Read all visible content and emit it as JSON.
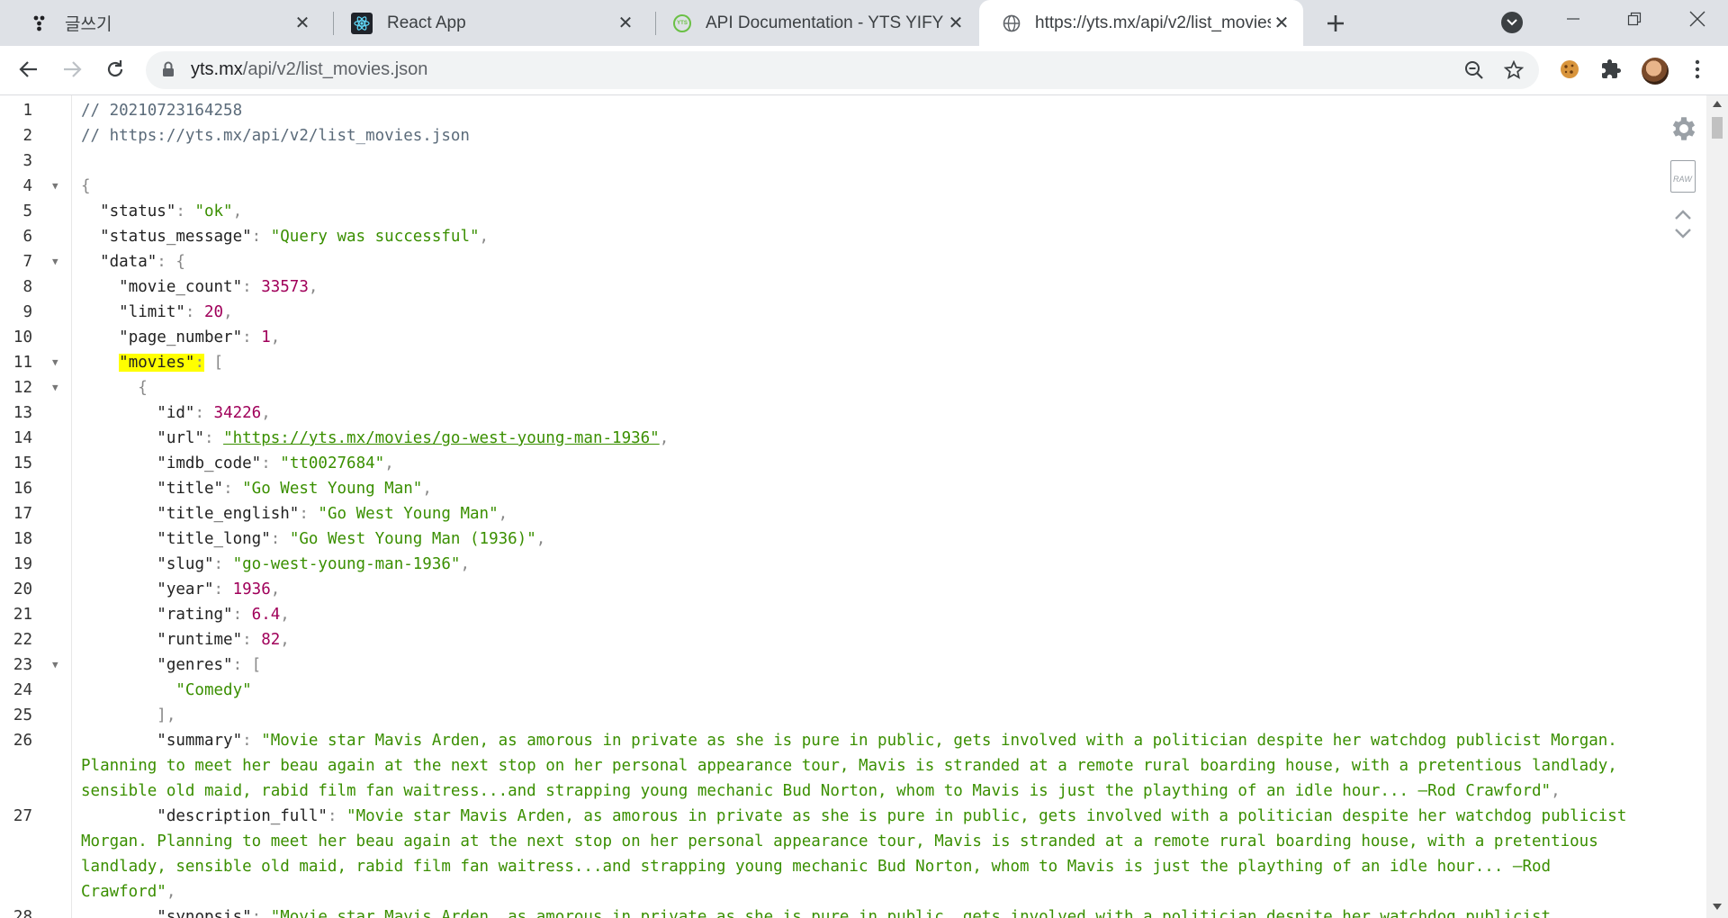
{
  "tabs": [
    {
      "title": "글쓰기",
      "icon": "velog-icon"
    },
    {
      "title": "React App",
      "icon": "react-icon"
    },
    {
      "title": "API Documentation - YTS YIFY",
      "icon": "yts-icon"
    },
    {
      "title": "https://yts.mx/api/v2/list_movies.json",
      "icon": "globe-icon"
    }
  ],
  "address_bar": {
    "host": "yts.mx",
    "path": "/api/v2/list_movies.json"
  },
  "lines": [
    {
      "n": "1",
      "html": "<span class='c'>// 20210723164258</span>"
    },
    {
      "n": "2",
      "html": "<span class='c'>// https://yts.mx/api/v2/list_movies.json</span>"
    },
    {
      "n": "3",
      "html": ""
    },
    {
      "n": "4",
      "fold": true,
      "html": "<span class='p'>{</span>"
    },
    {
      "n": "5",
      "html": "  <span class='k'>\"status\"</span><span class='p'>: </span><span class='s'>\"ok\"</span><span class='p'>,</span>"
    },
    {
      "n": "6",
      "html": "  <span class='k'>\"status_message\"</span><span class='p'>: </span><span class='s'>\"Query was successful\"</span><span class='p'>,</span>"
    },
    {
      "n": "7",
      "fold": true,
      "html": "  <span class='k'>\"data\"</span><span class='p'>: {</span>"
    },
    {
      "n": "8",
      "html": "    <span class='k'>\"movie_count\"</span><span class='p'>: </span><span class='n'>33573</span><span class='p'>,</span>"
    },
    {
      "n": "9",
      "html": "    <span class='k'>\"limit\"</span><span class='p'>: </span><span class='n'>20</span><span class='p'>,</span>"
    },
    {
      "n": "10",
      "html": "    <span class='k'>\"page_number\"</span><span class='p'>: </span><span class='n'>1</span><span class='p'>,</span>"
    },
    {
      "n": "11",
      "fold": true,
      "html": "    <span class='k hl'>\"movies\"</span><span class='p hl'>:</span><span class='p'> [</span>"
    },
    {
      "n": "12",
      "fold": true,
      "html": "      <span class='p'>{</span>"
    },
    {
      "n": "13",
      "html": "        <span class='k'>\"id\"</span><span class='p'>: </span><span class='n'>34226</span><span class='p'>,</span>"
    },
    {
      "n": "14",
      "html": "        <span class='k'>\"url\"</span><span class='p'>: </span><span class='link'>\"https://yts.mx/movies/go-west-young-man-1936\"</span><span class='p'>,</span>"
    },
    {
      "n": "15",
      "html": "        <span class='k'>\"imdb_code\"</span><span class='p'>: </span><span class='s'>\"tt0027684\"</span><span class='p'>,</span>"
    },
    {
      "n": "16",
      "html": "        <span class='k'>\"title\"</span><span class='p'>: </span><span class='s'>\"Go West Young Man\"</span><span class='p'>,</span>"
    },
    {
      "n": "17",
      "html": "        <span class='k'>\"title_english\"</span><span class='p'>: </span><span class='s'>\"Go West Young Man\"</span><span class='p'>,</span>"
    },
    {
      "n": "18",
      "html": "        <span class='k'>\"title_long\"</span><span class='p'>: </span><span class='s'>\"Go West Young Man (1936)\"</span><span class='p'>,</span>"
    },
    {
      "n": "19",
      "html": "        <span class='k'>\"slug\"</span><span class='p'>: </span><span class='s'>\"go-west-young-man-1936\"</span><span class='p'>,</span>"
    },
    {
      "n": "20",
      "html": "        <span class='k'>\"year\"</span><span class='p'>: </span><span class='n'>1936</span><span class='p'>,</span>"
    },
    {
      "n": "21",
      "html": "        <span class='k'>\"rating\"</span><span class='p'>: </span><span class='n'>6.4</span><span class='p'>,</span>"
    },
    {
      "n": "22",
      "html": "        <span class='k'>\"runtime\"</span><span class='p'>: </span><span class='n'>82</span><span class='p'>,</span>"
    },
    {
      "n": "23",
      "fold": true,
      "html": "        <span class='k'>\"genres\"</span><span class='p'>: [</span>"
    },
    {
      "n": "24",
      "html": "          <span class='s'>\"Comedy\"</span>"
    },
    {
      "n": "25",
      "html": "        <span class='p'>],</span>"
    },
    {
      "n": "26",
      "wrap": 3,
      "html": "        <span class='k'>\"summary\"</span><span class='p'>: </span><span class='s'>\"Movie star Mavis Arden, as amorous in private as she is pure in public, gets involved with a politician despite her watchdog publicist Morgan. Planning to meet her beau again at the next stop on her personal appearance tour, Mavis is stranded at a remote rural boarding house, with a pretentious landlady, sensible old maid, rabid film fan waitress...and strapping young mechanic Bud Norton, whom to Mavis is just the plaything of an idle hour... —Rod Crawford\"</span><span class='p'>,</span>"
    },
    {
      "n": "27",
      "wrap": 4,
      "html": "        <span class='k'>\"description_full\"</span><span class='p'>: </span><span class='s'>\"Movie star Mavis Arden, as amorous in private as she is pure in public, gets involved with a politician despite her watchdog publicist Morgan. Planning to meet her beau again at the next stop on her personal appearance tour, Mavis is stranded at a remote rural boarding house, with a pretentious landlady, sensible old maid, rabid film fan waitress...and strapping young mechanic Bud Norton, whom to Mavis is just the plaything of an idle hour... —Rod Crawford\"</span><span class='p'>,</span>"
    },
    {
      "n": "28",
      "html": "        <span class='k'>\"synopsis\"</span><span class='p'>: </span><span class='s'>\"Movie star Mavis Arden, as amorous in private as she is pure in public, gets involved with a politician despite her watchdog publicist</span>"
    }
  ],
  "side_tools": {
    "raw_label": "RAW"
  }
}
